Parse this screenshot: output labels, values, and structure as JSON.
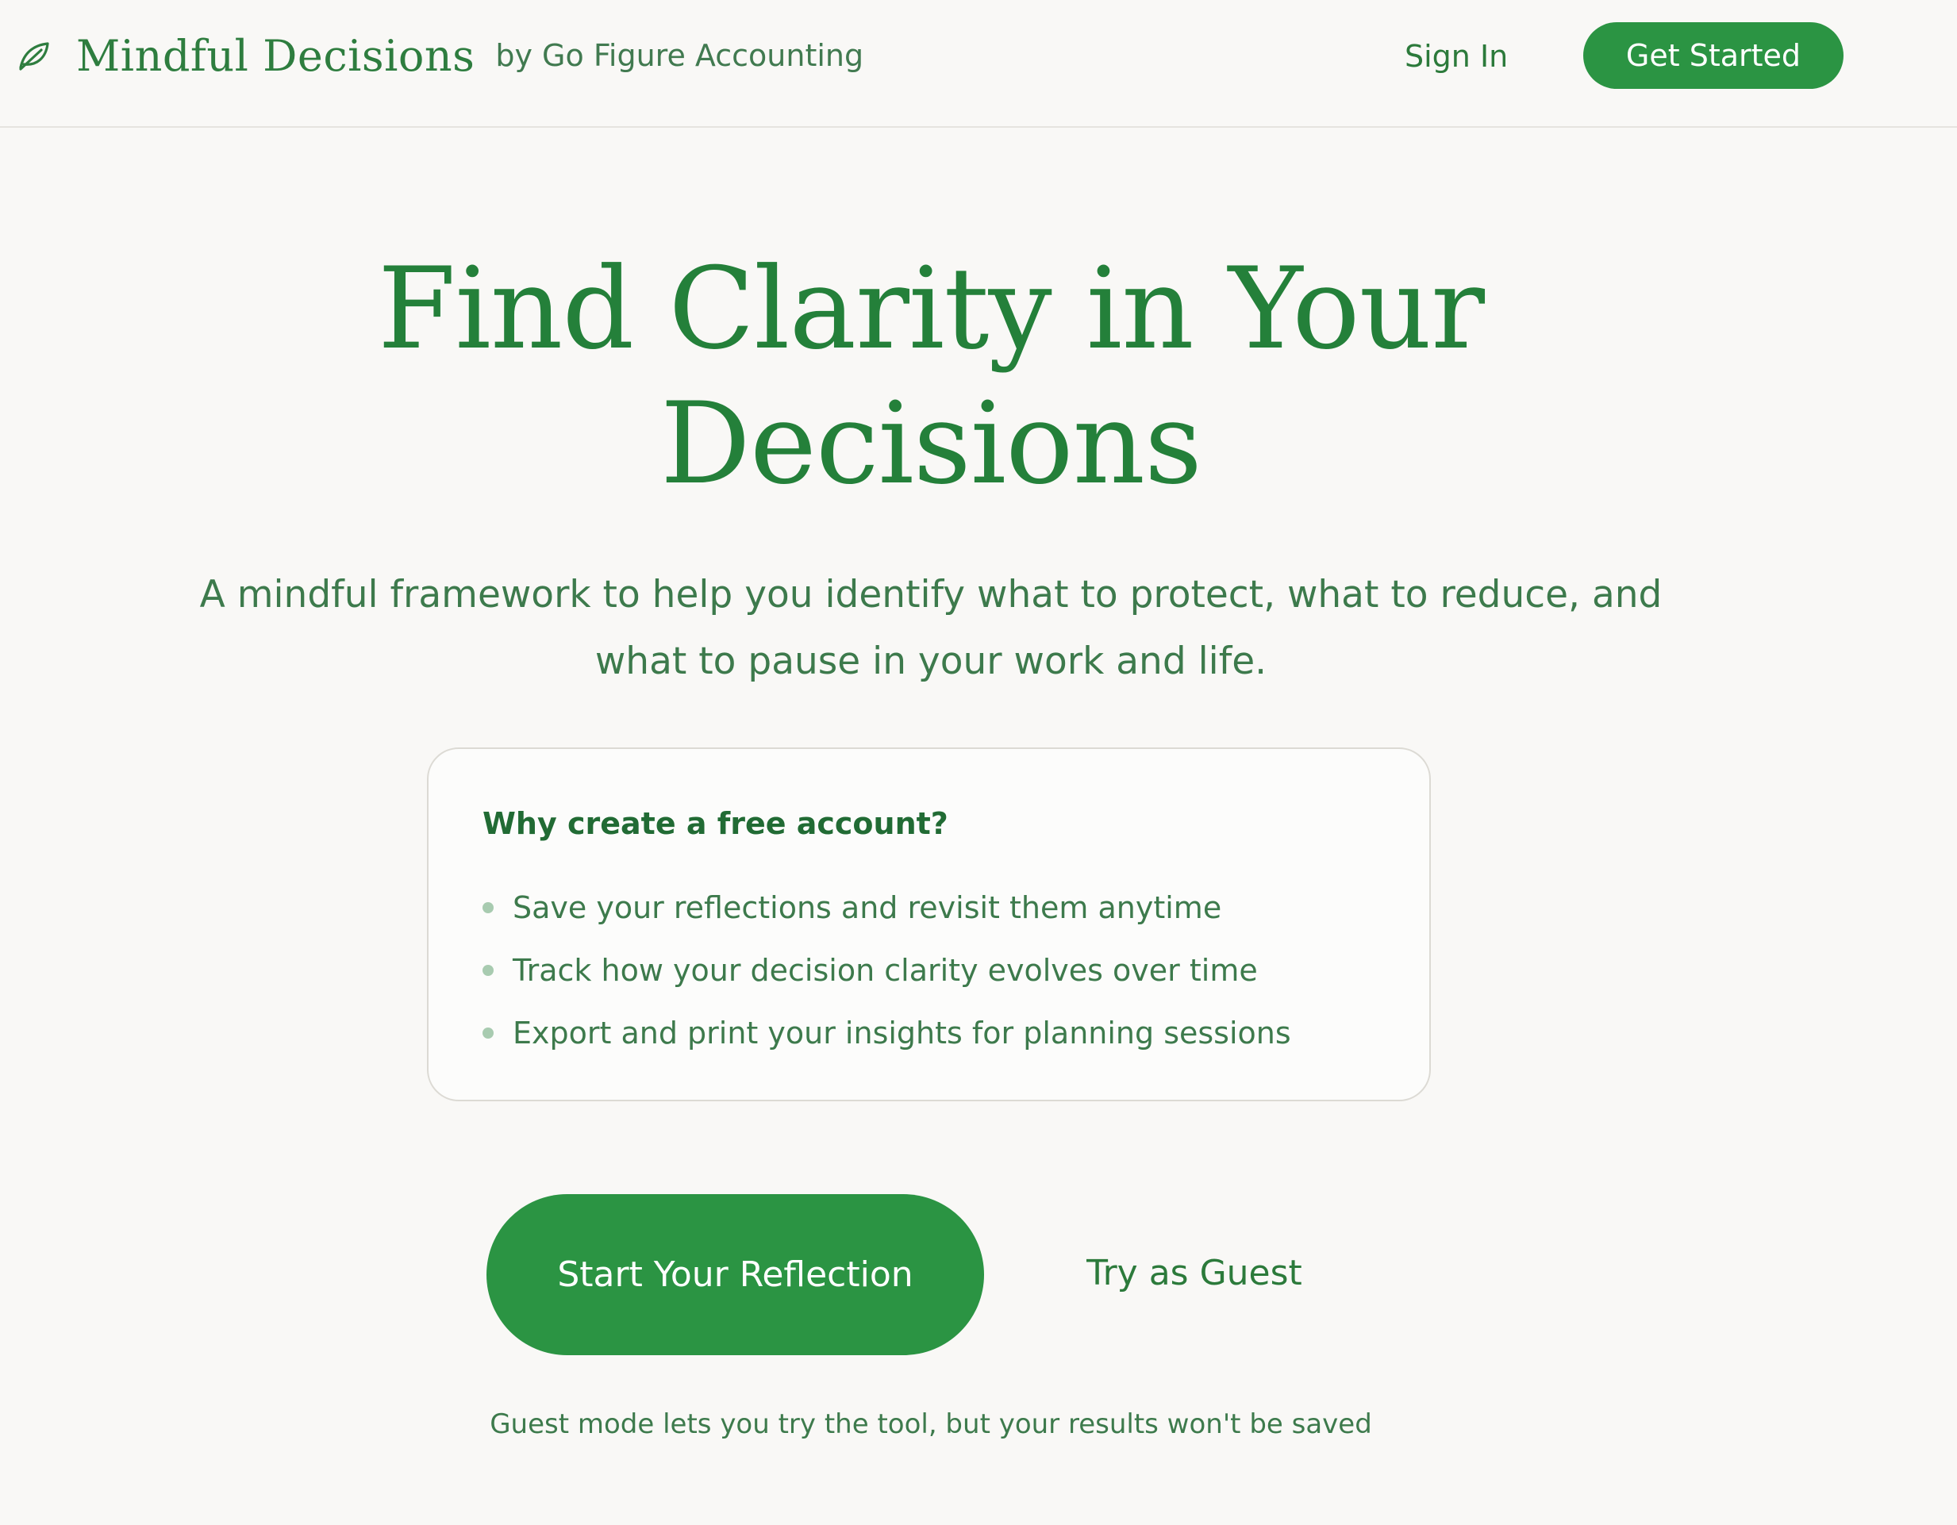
{
  "header": {
    "brand_name": "Mindful Decisions",
    "brand_by": "by Go Figure Accounting",
    "brand_icon": "leaf-icon",
    "nav": {
      "sign_in_label": "Sign In",
      "get_started_label": "Get Started"
    }
  },
  "hero": {
    "title": "Find Clarity in Your Decisions",
    "subtitle": "A mindful framework to help you identify what to protect, what to reduce, and what to pause in your work and life."
  },
  "benefits_card": {
    "title": "Why create a free account?",
    "items": [
      {
        "label": "Save your reflections and revisit them anytime"
      },
      {
        "label": "Track how your decision clarity evolves over time"
      },
      {
        "label": "Export and print your insights for planning sessions"
      }
    ]
  },
  "cta": {
    "primary_label": "Start Your Reflection",
    "secondary_label": "Try as Guest",
    "note": "Guest mode lets you try the tool, but your results won't be saved"
  },
  "colors": {
    "background": "#f9f8f6",
    "accent": "#2b9443",
    "heading": "#24803a",
    "text": "#3d7a4c",
    "bullet": "#a8cbb0"
  }
}
